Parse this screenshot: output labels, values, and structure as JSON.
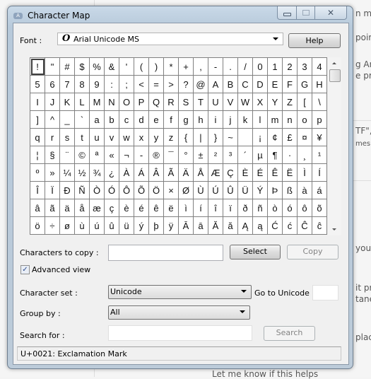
{
  "window": {
    "title": "Character Map",
    "app_icon": "charmap-icon"
  },
  "background_text": [
    "n my",
    "poir",
    "g Aria",
    "e pro",
    "TF\", (",
    "mes ]",
    "your",
    "it pr",
    "tane",
    "place",
    "Let me know if this helps"
  ],
  "font": {
    "label": "Font :",
    "value": "Arial Unicode MS",
    "font_type_icon": "opentype-icon",
    "help_label": "Help"
  },
  "grid": {
    "rows": [
      [
        "!",
        "\"",
        "#",
        "$",
        "%",
        "&",
        "'",
        "(",
        ")",
        "*",
        "+",
        ",",
        "-",
        ".",
        "/",
        "0",
        "1",
        "2",
        "3",
        "4"
      ],
      [
        "5",
        "6",
        "7",
        "8",
        "9",
        ":",
        ";",
        "<",
        "=",
        ">",
        "?",
        "@",
        "A",
        "B",
        "C",
        "D",
        "E",
        "F",
        "G",
        "H"
      ],
      [
        "I",
        "J",
        "K",
        "L",
        "M",
        "N",
        "O",
        "P",
        "Q",
        "R",
        "S",
        "T",
        "U",
        "V",
        "W",
        "X",
        "Y",
        "Z",
        "[",
        "\\"
      ],
      [
        "]",
        "^",
        "_",
        "`",
        "a",
        "b",
        "c",
        "d",
        "e",
        "f",
        "g",
        "h",
        "i",
        "j",
        "k",
        "l",
        "m",
        "n",
        "o",
        "p"
      ],
      [
        "q",
        "r",
        "s",
        "t",
        "u",
        "v",
        "w",
        "x",
        "y",
        "z",
        "{",
        "|",
        "}",
        "~",
        " ",
        "¡",
        "¢",
        "£",
        "¤",
        "¥"
      ],
      [
        "¦",
        "§",
        "¨",
        "©",
        "ª",
        "«",
        "¬",
        "-",
        "®",
        "¯",
        "°",
        "±",
        "²",
        "³",
        "´",
        "µ",
        "¶",
        "·",
        "¸",
        "¹"
      ],
      [
        "º",
        "»",
        "¼",
        "½",
        "¾",
        "¿",
        "À",
        "Á",
        "Â",
        "Ã",
        "Ä",
        "Å",
        "Æ",
        "Ç",
        "È",
        "É",
        "Ê",
        "Ë",
        "Ì",
        "Í"
      ],
      [
        "Î",
        "Ï",
        "Ð",
        "Ñ",
        "Ò",
        "Ó",
        "Ô",
        "Õ",
        "Ö",
        "×",
        "Ø",
        "Ù",
        "Ú",
        "Û",
        "Ü",
        "Ý",
        "Þ",
        "ß",
        "à",
        "á"
      ],
      [
        "â",
        "ã",
        "ä",
        "å",
        "æ",
        "ç",
        "è",
        "é",
        "ê",
        "ë",
        "ì",
        "í",
        "î",
        "ï",
        "ð",
        "ñ",
        "ò",
        "ó",
        "ô",
        "õ"
      ],
      [
        "ö",
        "÷",
        "ø",
        "ù",
        "ú",
        "û",
        "ü",
        "ý",
        "þ",
        "ÿ",
        "Ā",
        "ā",
        "Ă",
        "ă",
        "Ą",
        "ą",
        "Ć",
        "ć",
        "Ĉ",
        "ĉ"
      ]
    ],
    "selected": "!"
  },
  "copy": {
    "label": "Characters to copy :",
    "value": "",
    "select_label": "Select",
    "copy_label": "Copy"
  },
  "advanced_view": {
    "label": "Advanced view",
    "checked": true
  },
  "character_set": {
    "label": "Character set :",
    "value": "Unicode"
  },
  "goto_unicode": {
    "label": "Go to Unicode :",
    "value": ""
  },
  "group_by": {
    "label": "Group by :",
    "value": "All"
  },
  "search": {
    "label": "Search for :",
    "value": "",
    "button_label": "Search"
  },
  "status": {
    "text": "U+0021: Exclamation Mark"
  }
}
